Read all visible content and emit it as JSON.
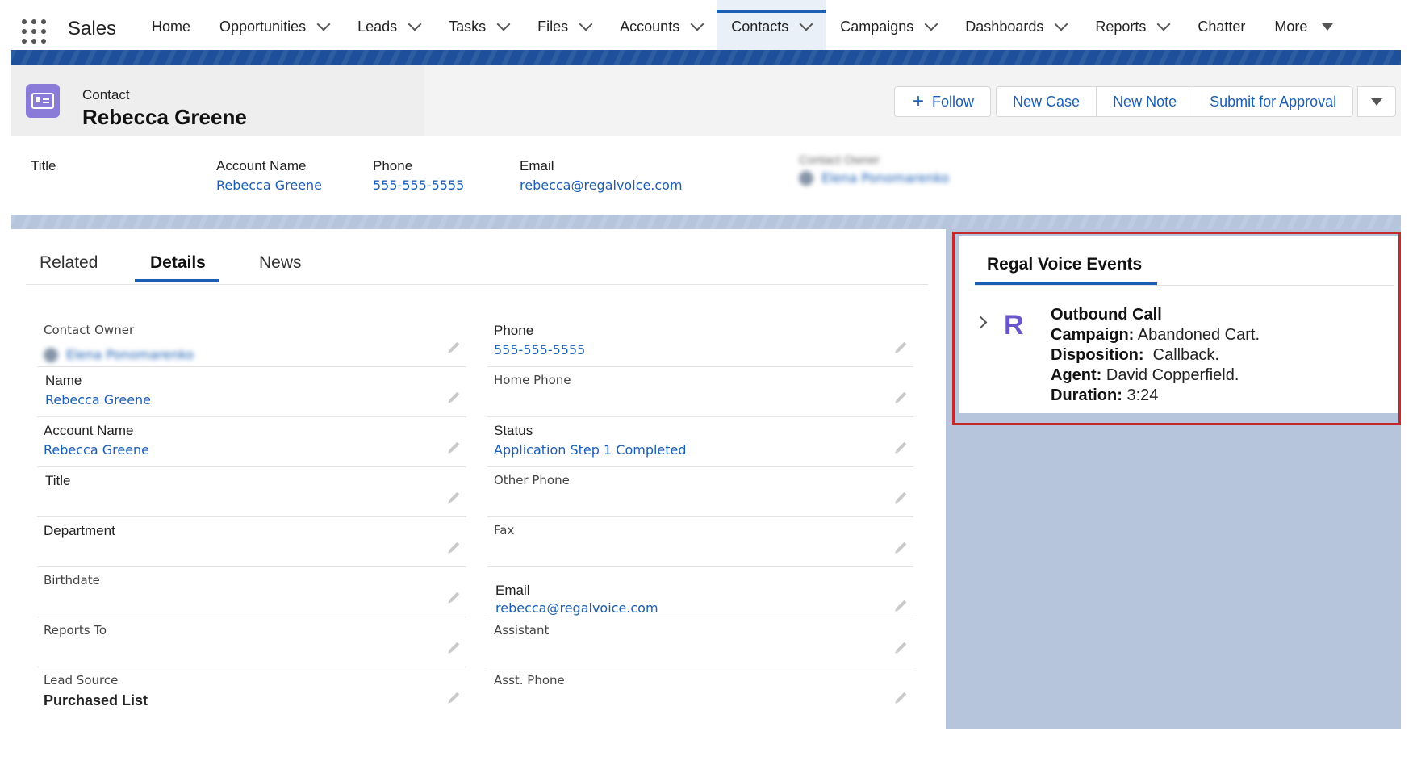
{
  "app": {
    "name": "Sales"
  },
  "nav": {
    "items": [
      {
        "label": "Home",
        "chevron": false
      },
      {
        "label": "Opportunities",
        "chevron": true
      },
      {
        "label": "Leads",
        "chevron": true
      },
      {
        "label": "Tasks",
        "chevron": true
      },
      {
        "label": "Files",
        "chevron": true
      },
      {
        "label": "Accounts",
        "chevron": true
      },
      {
        "label": "Contacts",
        "chevron": true,
        "active": true
      },
      {
        "label": "Campaigns",
        "chevron": true
      },
      {
        "label": "Dashboards",
        "chevron": true
      },
      {
        "label": "Reports",
        "chevron": true
      },
      {
        "label": "Chatter",
        "chevron": false
      },
      {
        "label": "More",
        "triangle": true
      }
    ]
  },
  "record": {
    "type": "Contact",
    "name": "Rebecca Greene",
    "actions": {
      "follow": "Follow",
      "new_case": "New Case",
      "new_note": "New Note",
      "submit": "Submit for Approval"
    }
  },
  "highlights": {
    "title_label": "Title",
    "account_label": "Account Name",
    "account_value": "Rebecca Greene",
    "phone_label": "Phone",
    "phone_value": "555-555-5555",
    "email_label": "Email",
    "email_value": "rebecca@regalvoice.com",
    "owner_label": "Contact Owner",
    "owner_value": "Elena Ponomarenko"
  },
  "tabs": {
    "related": "Related",
    "details": "Details",
    "news": "News"
  },
  "details": {
    "left": {
      "contact_owner": {
        "label": "Contact Owner",
        "value": "Elena Ponomarenko"
      },
      "name": {
        "label": "Name",
        "value": "Rebecca Greene"
      },
      "account_name": {
        "label": "Account Name",
        "value": "Rebecca Greene"
      },
      "title": {
        "label": "Title"
      },
      "department": {
        "label": "Department"
      },
      "birthdate": {
        "label": "Birthdate"
      },
      "reports_to": {
        "label": "Reports To"
      },
      "lead_source": {
        "label": "Lead Source",
        "value": "Purchased List"
      }
    },
    "right": {
      "phone": {
        "label": "Phone",
        "value": "555-555-5555"
      },
      "home_phone": {
        "label": "Home Phone"
      },
      "status": {
        "label": "Status",
        "value": "Application Step 1 Completed"
      },
      "other_phone": {
        "label": "Other Phone"
      },
      "fax": {
        "label": "Fax"
      },
      "email": {
        "label": "Email",
        "value": "rebecca@regalvoice.com"
      },
      "assistant": {
        "label": "Assistant"
      },
      "asst_phone": {
        "label": "Asst. Phone"
      }
    }
  },
  "regal": {
    "title": "Regal Voice Events",
    "logo": "R",
    "event": {
      "heading": "Outbound Call",
      "campaign_label": "Campaign:",
      "campaign_value": "Abandoned Cart.",
      "disposition_label": "Disposition:",
      "disposition_value": "Callback.",
      "agent_label": "Agent:",
      "agent_value": "David Copperfield.",
      "duration_label": "Duration:",
      "duration_value": "3:24"
    }
  },
  "colors": {
    "accent": "#1b5fb4",
    "brand_bar": "#1d4f9a",
    "highlight_box": "#c52a2a",
    "contact_icon": "#8b7bd8"
  }
}
